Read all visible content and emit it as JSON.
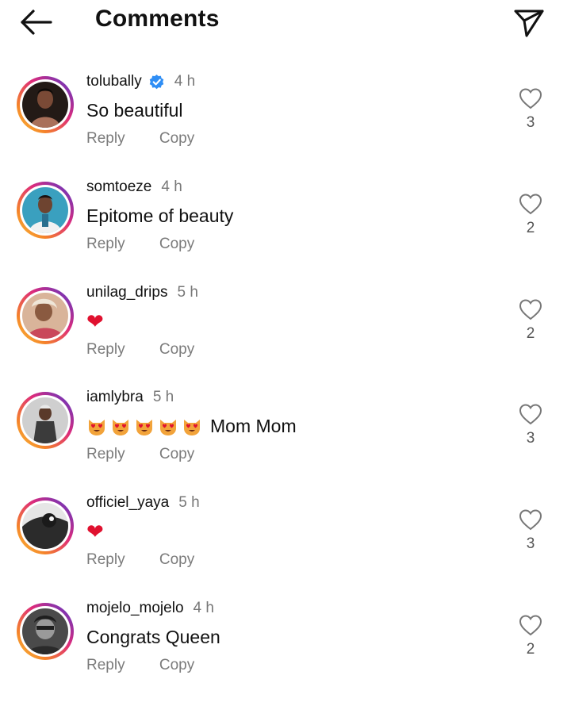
{
  "header": {
    "title": "Comments",
    "back_icon": "arrow-left-icon",
    "share_icon": "paper-plane-icon"
  },
  "colors": {
    "heart": "#e0112f",
    "verified": "#2f8ef5",
    "ring_start": "#f9c23c",
    "ring_end": "#b13fb7",
    "secondary_text": "#7b7b7b"
  },
  "comments": [
    {
      "username": "tolubally",
      "verified": true,
      "time": "4 h",
      "text": "So beautiful",
      "reply_label": "Reply",
      "copy_label": "Copy",
      "likes": "3"
    },
    {
      "username": "somtoeze",
      "verified": false,
      "time": "4 h",
      "text": "Epitome of beauty",
      "reply_label": "Reply",
      "copy_label": "Copy",
      "likes": "2"
    },
    {
      "username": "unilag_drips",
      "verified": false,
      "time": "5 h",
      "text": "❤",
      "reply_label": "Reply",
      "copy_label": "Copy",
      "likes": "2"
    },
    {
      "username": "iamlybra",
      "verified": false,
      "time": "5 h",
      "text": "Mom Mom",
      "emoji_icons": [
        "heart-eyes-cat-icon",
        "heart-eyes-cat-icon",
        "heart-eyes-cat-icon",
        "heart-eyes-cat-icon",
        "heart-eyes-cat-icon"
      ],
      "reply_label": "Reply",
      "copy_label": "Copy",
      "likes": "3"
    },
    {
      "username": "officiel_yaya",
      "verified": false,
      "time": "5 h",
      "text": "❤",
      "reply_label": "Reply",
      "copy_label": "Copy",
      "likes": "3"
    },
    {
      "username": "mojelo_mojelo",
      "verified": false,
      "time": "4 h",
      "text": "Congrats Queen",
      "reply_label": "Reply",
      "copy_label": "Copy",
      "likes": "2"
    }
  ]
}
